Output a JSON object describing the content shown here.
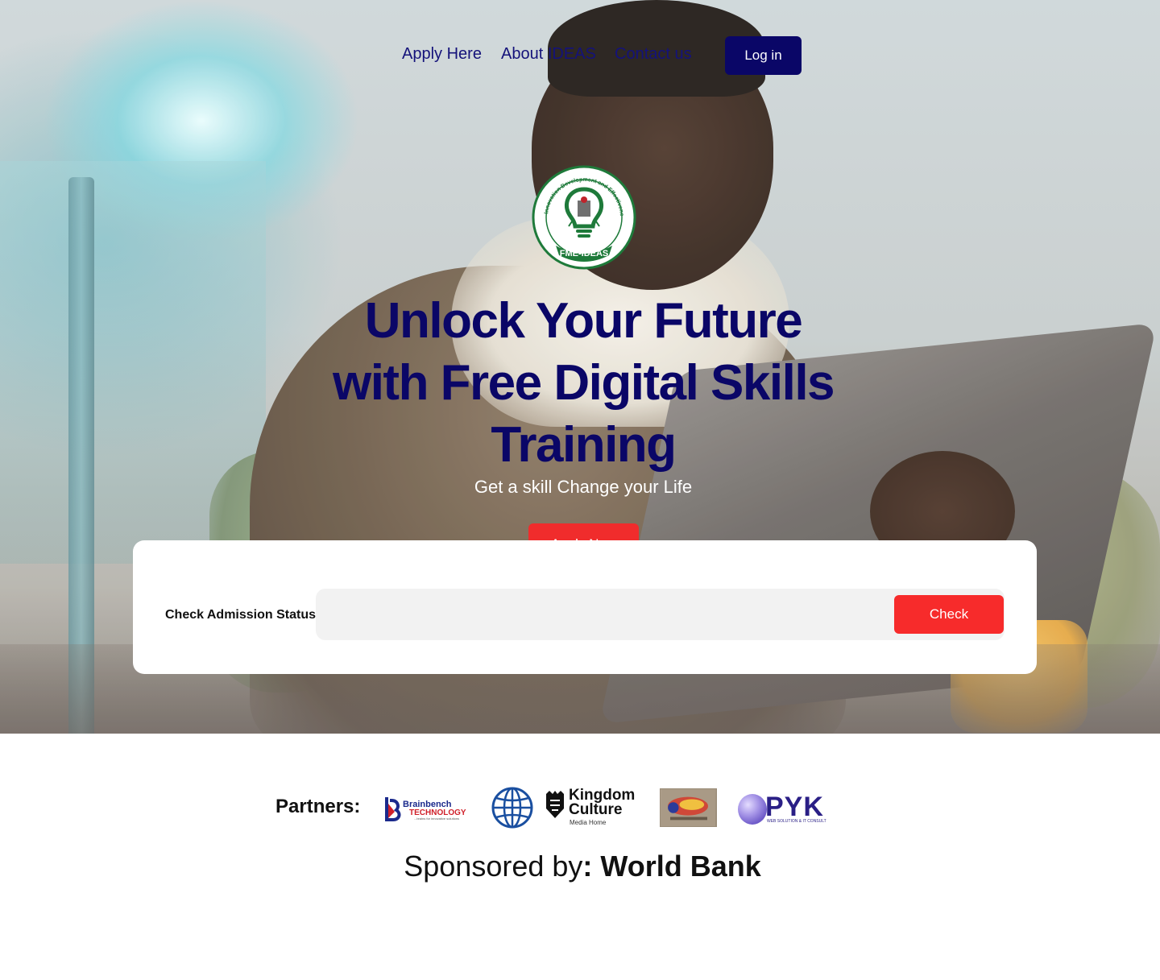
{
  "nav": {
    "links": [
      "Apply Here",
      "About IDEAS",
      "Contact us"
    ],
    "login_label": "Log in"
  },
  "emblem": {
    "ring_text": "Innovation Development and Effectiveness in the Acquisition of Skills",
    "banner_text": "FME-IDEAS"
  },
  "hero": {
    "headline": "Unlock Your Future with Free Digital Skills Training",
    "subline": "Get a skill Change your Life",
    "cta_label": "Apply Now"
  },
  "admission": {
    "label": "Check Admission Status",
    "input_value": "",
    "input_placeholder": "",
    "button_label": "Check"
  },
  "partners": {
    "label": "Partners:",
    "brainbench": {
      "line1": "Brainbench",
      "line2": "TECHNOLOGY",
      "tagline": "...brains for innovative solutions"
    },
    "kingdom": {
      "line1": "Kingdom",
      "line2": "Culture",
      "line3": "Media Home"
    },
    "pyk": {
      "name": "PYK",
      "tagline": "WEB SOLUTION & IT CONSULT"
    },
    "items": [
      "brainbench-logo",
      "globe-logo",
      "kingdom-culture-logo",
      "esg-logo",
      "pyk-logo"
    ]
  },
  "sponsor": {
    "prefix": "Sponsored by",
    "name": ": World Bank"
  },
  "colors": {
    "navy": "#0a0667",
    "red": "#f72b2b",
    "emblem_green": "#1e7a3a"
  }
}
